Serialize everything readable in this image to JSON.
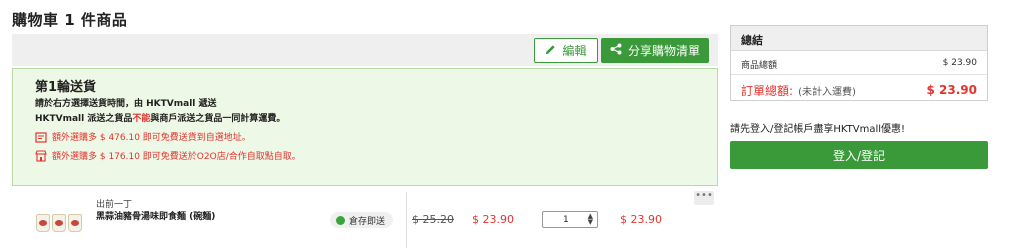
{
  "page": {
    "title": "購物車 1 件商品"
  },
  "toolbar": {
    "edit_label": "編輯",
    "share_label": "分享購物清單"
  },
  "delivery": {
    "title": "第1輪送貨",
    "note1": "請於右方選擇送貨時間，由 HKTVmall 遞送",
    "note2_part1": "HKTVmall 派送之貨品",
    "note2_red": "不能",
    "note2_part2": "與商戶派送之貨品一同計算運費。",
    "promo_home": "額外選購多 $ 476.10 即可免費送貨到自選地址。",
    "promo_o2o": "額外選購多 $ 176.10 即可免費送於O2O店/合作自取點自取。"
  },
  "product": {
    "brand": "出前一丁",
    "name": "黑蒜油豬骨湯味即食麵 (碗麵)",
    "stock_label": "倉存即送",
    "old_price": "$ 25.20",
    "sale_price": "$ 23.90",
    "quantity": "1",
    "line_total": "$ 23.90",
    "more_label": "•••"
  },
  "summary": {
    "heading": "總結",
    "subtotal_label": "商品總額",
    "subtotal_value": "$ 23.90",
    "total_label": "訂單總額:",
    "total_note": "(未計入運費)",
    "total_value": "$ 23.90"
  },
  "login": {
    "prompt": "請先登入/登記帳戶盡享HKTVmall優惠!",
    "button_label": "登入/登記"
  },
  "colors": {
    "brand_green": "#3a9a3a",
    "alert_red": "#e3342f",
    "delivery_bg": "#eef8e6"
  }
}
